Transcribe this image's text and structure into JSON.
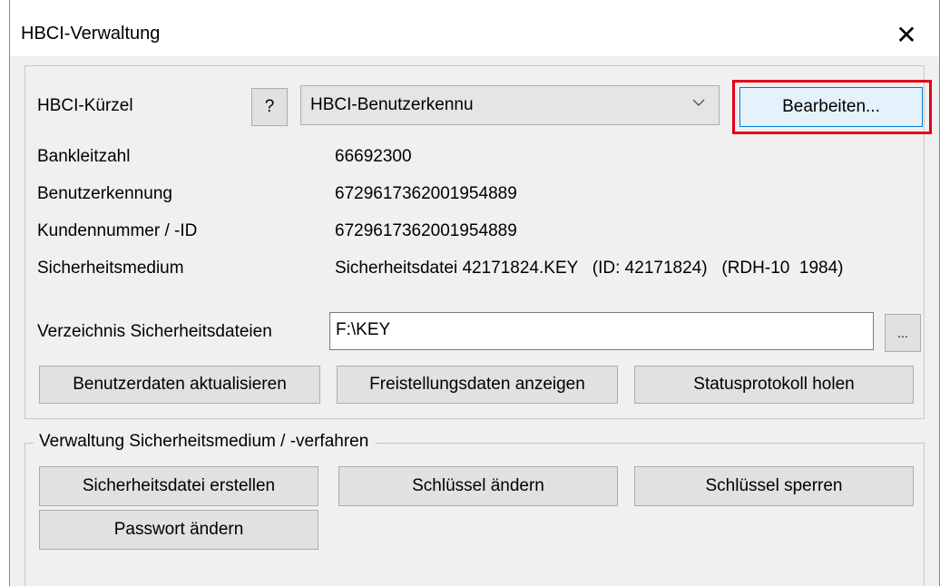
{
  "window": {
    "title": "HBCI-Verwaltung",
    "close_symbol": "✕"
  },
  "kuerzel": {
    "label": "HBCI-Kürzel",
    "help_label": "?",
    "selected": "HBCI-Benutzerkennu",
    "edit_label": "Bearbeiten...",
    "highlight_color": "#e3001b"
  },
  "info": {
    "rows": [
      {
        "label": "Bankleitzahl",
        "value": "66692300"
      },
      {
        "label": "Benutzerkennung",
        "value": "6729617362001954889"
      },
      {
        "label": "Kundennummer / -ID",
        "value": "6729617362001954889"
      },
      {
        "label": "Sicherheitsmedium",
        "value": "Sicherheitsdatei 42171824.KEY   (ID: 42171824)   (RDH-10  1984)"
      }
    ]
  },
  "directory": {
    "label": "Verzeichnis Sicherheitsdateien",
    "value": "F:\\KEY",
    "browse_label": "..."
  },
  "actions": {
    "update_user": "Benutzerdaten aktualisieren",
    "show_exemption": "Freistellungsdaten anzeigen",
    "fetch_status": "Statusprotokoll holen"
  },
  "security_group": {
    "legend": "Verwaltung Sicherheitsmedium / -verfahren",
    "create_file": "Sicherheitsdatei erstellen",
    "change_key": "Schlüssel ändern",
    "lock_key": "Schlüssel sperren",
    "change_password": "Passwort ändern"
  }
}
